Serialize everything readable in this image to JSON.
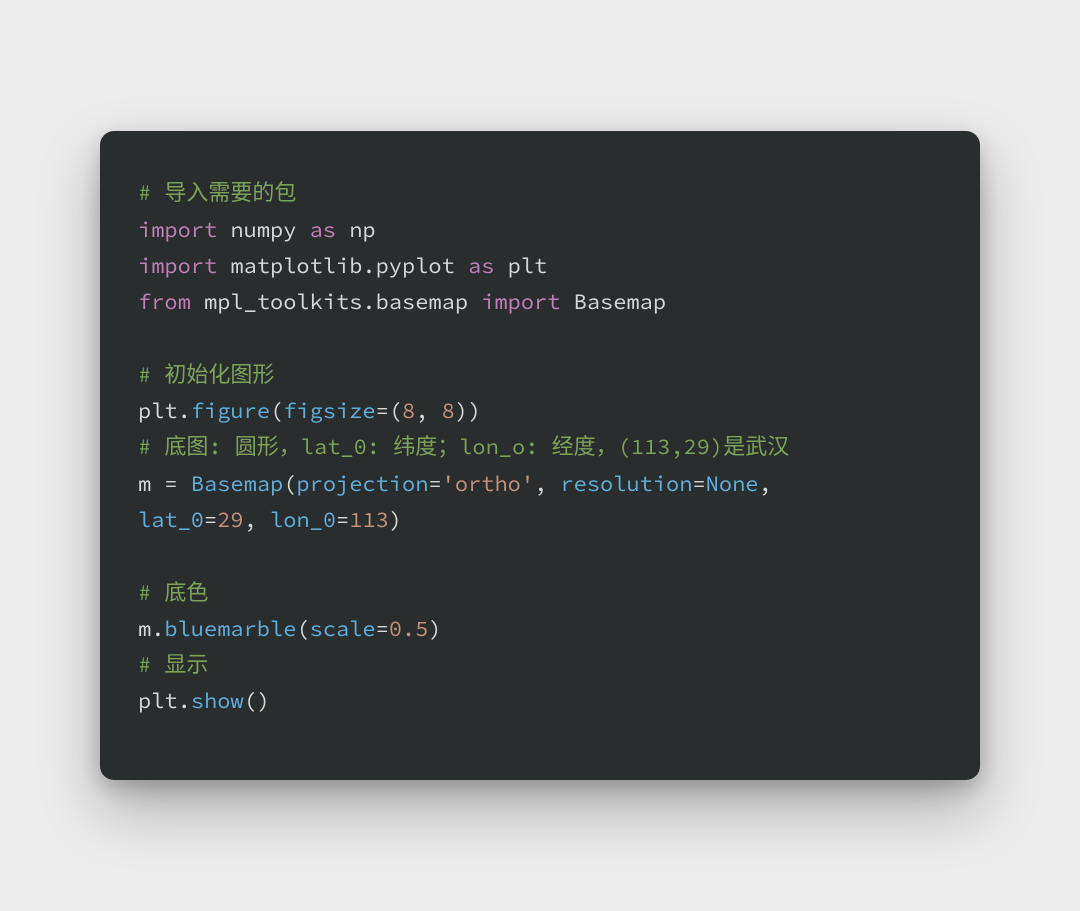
{
  "code": {
    "tokens": [
      [
        {
          "cls": "tok-comment",
          "text": "# 导入需要的包"
        }
      ],
      [
        {
          "cls": "tok-keyword",
          "text": "import"
        },
        {
          "cls": "tok-default",
          "text": " numpy "
        },
        {
          "cls": "tok-keyword",
          "text": "as"
        },
        {
          "cls": "tok-default",
          "text": " np"
        }
      ],
      [
        {
          "cls": "tok-keyword",
          "text": "import"
        },
        {
          "cls": "tok-default",
          "text": " matplotlib.pyplot "
        },
        {
          "cls": "tok-keyword",
          "text": "as"
        },
        {
          "cls": "tok-default",
          "text": " plt"
        }
      ],
      [
        {
          "cls": "tok-keyword",
          "text": "from"
        },
        {
          "cls": "tok-default",
          "text": " mpl_toolkits.basemap "
        },
        {
          "cls": "tok-keyword",
          "text": "import"
        },
        {
          "cls": "tok-default",
          "text": " Basemap"
        }
      ],
      [
        {
          "cls": "tok-default",
          "text": ""
        }
      ],
      [
        {
          "cls": "tok-comment",
          "text": "# 初始化图形"
        }
      ],
      [
        {
          "cls": "tok-default",
          "text": "plt."
        },
        {
          "cls": "tok-func",
          "text": "figure"
        },
        {
          "cls": "tok-punct",
          "text": "("
        },
        {
          "cls": "tok-param",
          "text": "figsize"
        },
        {
          "cls": "tok-punct",
          "text": "=("
        },
        {
          "cls": "tok-number",
          "text": "8"
        },
        {
          "cls": "tok-punct",
          "text": ", "
        },
        {
          "cls": "tok-number",
          "text": "8"
        },
        {
          "cls": "tok-punct",
          "text": "))"
        }
      ],
      [
        {
          "cls": "tok-comment",
          "text": "# 底图: 圆形，lat_0: 纬度；lon_o: 经度，(113,29)是武汉"
        }
      ],
      [
        {
          "cls": "tok-default",
          "text": "m = "
        },
        {
          "cls": "tok-func",
          "text": "Basemap"
        },
        {
          "cls": "tok-punct",
          "text": "("
        },
        {
          "cls": "tok-param",
          "text": "projection"
        },
        {
          "cls": "tok-punct",
          "text": "="
        },
        {
          "cls": "tok-string",
          "text": "'ortho'"
        },
        {
          "cls": "tok-punct",
          "text": ", "
        },
        {
          "cls": "tok-param",
          "text": "resolution"
        },
        {
          "cls": "tok-punct",
          "text": "="
        },
        {
          "cls": "tok-const",
          "text": "None"
        },
        {
          "cls": "tok-punct",
          "text": ","
        }
      ],
      [
        {
          "cls": "tok-param",
          "text": "lat_0"
        },
        {
          "cls": "tok-punct",
          "text": "="
        },
        {
          "cls": "tok-number",
          "text": "29"
        },
        {
          "cls": "tok-punct",
          "text": ", "
        },
        {
          "cls": "tok-param",
          "text": "lon_0"
        },
        {
          "cls": "tok-punct",
          "text": "="
        },
        {
          "cls": "tok-number",
          "text": "113"
        },
        {
          "cls": "tok-punct",
          "text": ")"
        }
      ],
      [
        {
          "cls": "tok-default",
          "text": ""
        }
      ],
      [
        {
          "cls": "tok-comment",
          "text": "# 底色"
        }
      ],
      [
        {
          "cls": "tok-default",
          "text": "m."
        },
        {
          "cls": "tok-func",
          "text": "bluemarble"
        },
        {
          "cls": "tok-punct",
          "text": "("
        },
        {
          "cls": "tok-param",
          "text": "scale"
        },
        {
          "cls": "tok-punct",
          "text": "="
        },
        {
          "cls": "tok-number",
          "text": "0.5"
        },
        {
          "cls": "tok-punct",
          "text": ")"
        }
      ],
      [
        {
          "cls": "tok-comment",
          "text": "# 显示"
        }
      ],
      [
        {
          "cls": "tok-default",
          "text": "plt."
        },
        {
          "cls": "tok-func",
          "text": "show"
        },
        {
          "cls": "tok-punct",
          "text": "()"
        }
      ]
    ]
  }
}
